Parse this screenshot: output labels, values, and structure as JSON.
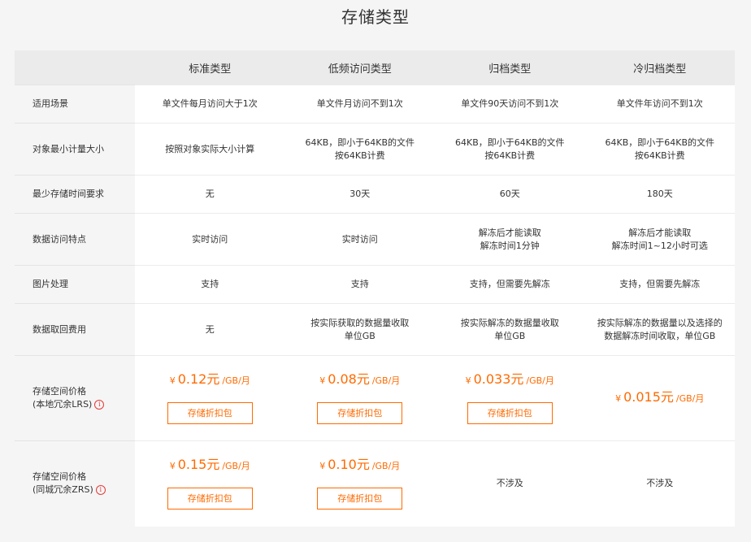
{
  "page": {
    "title": "存储类型"
  },
  "table": {
    "headers": [
      "",
      "标准类型",
      "低频访问类型",
      "归档类型",
      "冷归档类型"
    ],
    "rows": [
      {
        "label": [
          "适用场景"
        ],
        "cells": [
          [
            "单文件每月访问大于1次"
          ],
          [
            "单文件月访问不到1次"
          ],
          [
            "单文件90天访问不到1次"
          ],
          [
            "单文件年访问不到1次"
          ]
        ]
      },
      {
        "label": [
          "对象最小计量大小"
        ],
        "cells": [
          [
            "按照对象实际大小计算"
          ],
          [
            "64KB，即小于64KB的文件",
            "按64KB计费"
          ],
          [
            "64KB，即小于64KB的文件",
            "按64KB计费"
          ],
          [
            "64KB，即小于64KB的文件",
            "按64KB计费"
          ]
        ]
      },
      {
        "label": [
          "最少存储时间要求"
        ],
        "cells": [
          [
            "无"
          ],
          [
            "30天"
          ],
          [
            "60天"
          ],
          [
            "180天"
          ]
        ]
      },
      {
        "label": [
          "数据访问特点"
        ],
        "cells": [
          [
            "实时访问"
          ],
          [
            "实时访问"
          ],
          [
            "解冻后才能读取",
            "解冻时间1分钟"
          ],
          [
            "解冻后才能读取",
            "解冻时间1~12小时可选"
          ]
        ]
      },
      {
        "label": [
          "图片处理"
        ],
        "cells": [
          [
            "支持"
          ],
          [
            "支持"
          ],
          [
            "支持，但需要先解冻"
          ],
          [
            "支持，但需要先解冻"
          ]
        ]
      },
      {
        "label": [
          "数据取回费用"
        ],
        "cells": [
          [
            "无"
          ],
          [
            "按实际获取的数据量收取",
            "单位GB"
          ],
          [
            "按实际解冻的数据量收取",
            "单位GB"
          ],
          [
            "按实际解冻的数据量以及选择的",
            "数据解冻时间收取，单位GB"
          ]
        ]
      }
    ],
    "price_rows": [
      {
        "label": [
          "存储空间价格",
          "(本地冗余LRS)"
        ],
        "cells": [
          {
            "currency": "¥",
            "amount": "0.12元",
            "unit": "/GB/月",
            "button": "存储折扣包"
          },
          {
            "currency": "¥",
            "amount": "0.08元",
            "unit": "/GB/月",
            "button": "存储折扣包"
          },
          {
            "currency": "¥",
            "amount": "0.033元",
            "unit": "/GB/月",
            "button": "存储折扣包"
          },
          {
            "currency": "¥",
            "amount": "0.015元",
            "unit": "/GB/月"
          }
        ]
      },
      {
        "label": [
          "存储空间价格",
          "(同城冗余ZRS)"
        ],
        "cells": [
          {
            "currency": "¥",
            "amount": "0.15元",
            "unit": "/GB/月",
            "button": "存储折扣包"
          },
          {
            "currency": "¥",
            "amount": "0.10元",
            "unit": "/GB/月",
            "button": "存储折扣包"
          },
          {
            "text": "不涉及"
          },
          {
            "text": "不涉及"
          }
        ]
      }
    ],
    "info_icon": "info-circle-icon",
    "accent_color": "#ff6a00"
  }
}
